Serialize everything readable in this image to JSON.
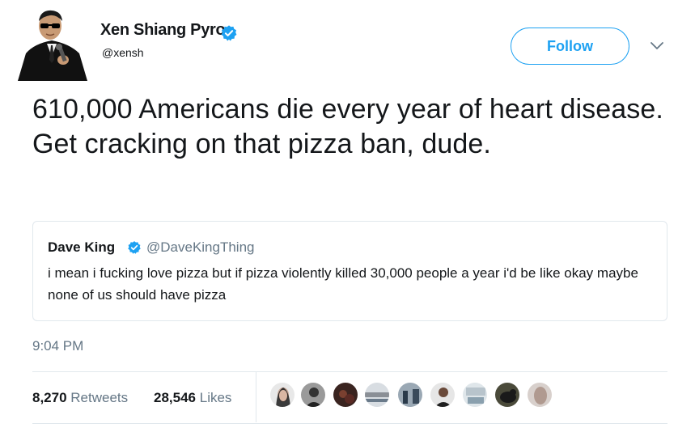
{
  "author": {
    "display_name": "Xen Shiang Pyro",
    "handle": "@xensh",
    "verified": true,
    "avatar_icon": "avatar-man-in-suit-icon"
  },
  "actions": {
    "follow_label": "Follow",
    "more_icon": "chevron-down-icon"
  },
  "tweet": {
    "text": "610,000 Americans die every year of heart disease. Get cracking on that pizza ban, dude."
  },
  "quoted_tweet": {
    "display_name": "Dave King",
    "handle": "@DaveKingThing",
    "verified": true,
    "text": "i mean i fucking love pizza but if pizza violently killed 30,000 people a year i'd be like okay maybe none of us should have pizza"
  },
  "timestamp": "9:04 PM",
  "stats": {
    "retweets_count": "8,270",
    "retweets_label": "Retweets",
    "likes_count": "28,546",
    "likes_label": "Likes"
  },
  "liker_avatars": [
    {
      "name": "liker-avatar-1",
      "color": "#2b2b2b"
    },
    {
      "name": "liker-avatar-2",
      "color": "#3a3a3a"
    },
    {
      "name": "liker-avatar-3",
      "color": "#4a2e2a"
    },
    {
      "name": "liker-avatar-4",
      "color": "#8a8f96"
    },
    {
      "name": "liker-avatar-5",
      "color": "#5a6a7a"
    },
    {
      "name": "liker-avatar-6",
      "color": "#3b3b3b"
    },
    {
      "name": "liker-avatar-7",
      "color": "#b8c4cc"
    },
    {
      "name": "liker-avatar-8",
      "color": "#2a2a2a"
    },
    {
      "name": "liker-avatar-9",
      "color": "#c9c2be"
    }
  ],
  "colors": {
    "brand_blue": "#1da1f2",
    "secondary_text": "#657786",
    "border": "#e1e8ed"
  }
}
